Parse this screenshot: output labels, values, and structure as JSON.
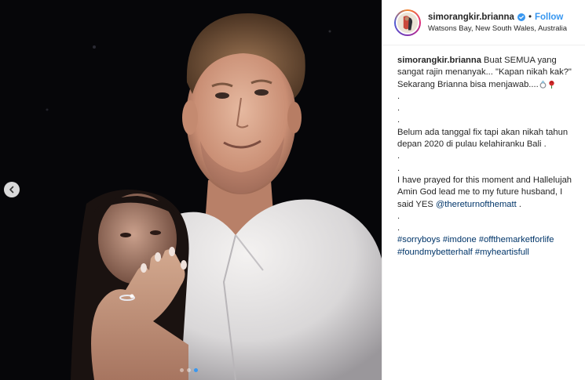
{
  "post": {
    "username": "simorangkir.brianna",
    "follow_label": "Follow",
    "location": "Watsons Bay, New South Wales, Australia",
    "caption": {
      "intro": "Buat SEMUA yang sangat rajin menanyak... \"Kapan nikah kak?\" Sekarang Brianna bisa menjawab....",
      "para2": "Belum ada tanggal fix tapi akan nikah tahun depan 2020 di pulau kelahiranku Bali .",
      "para3_before": "I have prayed for this moment and Hallelujah Amin God lead me to my future husband, I said YES ",
      "mention": "@thereturnofthematt",
      "para3_after": " .",
      "dot": "."
    },
    "hashtags": [
      "#sorryboys",
      "#imdone",
      "#offthemarketforlife",
      "#foundmybetterhalf",
      "#myheartisfull"
    ]
  },
  "carousel": {
    "slides": 3,
    "active_index": 2
  },
  "colors": {
    "follow": "#3897f0",
    "link": "#003569",
    "verified": "#3897f0",
    "photo_bg": "#07070a"
  },
  "icons": {
    "prev": "chevron-left-icon",
    "verified": "verified-badge-icon",
    "emoji_ring": "ring-icon",
    "emoji_rose": "rose-icon"
  }
}
